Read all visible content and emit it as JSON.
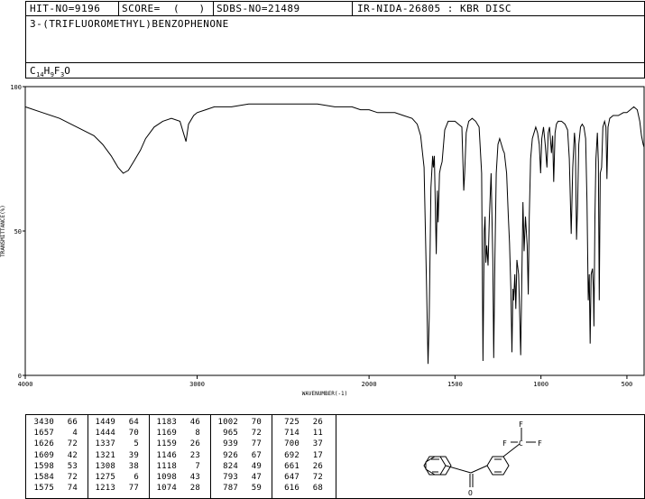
{
  "header": {
    "hit_no": "HIT-NO=9196",
    "score": "SCORE=  (   )",
    "sdbs_no": "SDBS-NO=21489",
    "ir_nida": "IR-NIDA-26805 : KBR DISC",
    "compound_name": "3-(TRIFLUOROMETHYL)BENZOPHENONE",
    "formula_parts": [
      "C",
      "14",
      "H",
      "9",
      "F",
      "3",
      "O"
    ]
  },
  "chart_data": {
    "type": "line",
    "xlabel": "WAVENUMBER(-1)",
    "ylabel": "TRANSMITTANCE(%)",
    "xlim": [
      4000,
      400
    ],
    "ylim": [
      0,
      100
    ],
    "x_ticks": [
      4000,
      3000,
      2000,
      1500,
      1000,
      500
    ],
    "x_tick_labels": [
      "4000",
      "3000",
      "2000",
      "1500",
      "1000",
      "500"
    ],
    "y_ticks": [
      0,
      50,
      100
    ],
    "y_tick_labels": [
      "0",
      "50",
      "100"
    ],
    "series": [
      {
        "points": [
          [
            4000,
            93
          ],
          [
            3900,
            91
          ],
          [
            3800,
            89
          ],
          [
            3700,
            86
          ],
          [
            3600,
            83
          ],
          [
            3550,
            80
          ],
          [
            3500,
            76
          ],
          [
            3460,
            72
          ],
          [
            3430,
            70
          ],
          [
            3400,
            71
          ],
          [
            3370,
            74
          ],
          [
            3330,
            78
          ],
          [
            3300,
            82
          ],
          [
            3250,
            86
          ],
          [
            3200,
            88
          ],
          [
            3150,
            89
          ],
          [
            3100,
            88
          ],
          [
            3080,
            84
          ],
          [
            3065,
            81
          ],
          [
            3050,
            87
          ],
          [
            3020,
            90
          ],
          [
            3000,
            91
          ],
          [
            2950,
            92
          ],
          [
            2900,
            93
          ],
          [
            2800,
            93
          ],
          [
            2700,
            94
          ],
          [
            2600,
            94
          ],
          [
            2500,
            94
          ],
          [
            2400,
            94
          ],
          [
            2300,
            94
          ],
          [
            2200,
            93
          ],
          [
            2100,
            93
          ],
          [
            2050,
            92
          ],
          [
            2000,
            92
          ],
          [
            1950,
            91
          ],
          [
            1900,
            91
          ],
          [
            1850,
            91
          ],
          [
            1800,
            90
          ],
          [
            1750,
            89
          ],
          [
            1720,
            87
          ],
          [
            1700,
            83
          ],
          [
            1680,
            72
          ],
          [
            1665,
            30
          ],
          [
            1657,
            4
          ],
          [
            1650,
            20
          ],
          [
            1640,
            65
          ],
          [
            1630,
            76
          ],
          [
            1626,
            72
          ],
          [
            1620,
            76
          ],
          [
            1609,
            42
          ],
          [
            1603,
            64
          ],
          [
            1598,
            53
          ],
          [
            1590,
            70
          ],
          [
            1584,
            72
          ],
          [
            1575,
            74
          ],
          [
            1560,
            85
          ],
          [
            1540,
            88
          ],
          [
            1520,
            88
          ],
          [
            1500,
            88
          ],
          [
            1480,
            87
          ],
          [
            1460,
            86
          ],
          [
            1449,
            64
          ],
          [
            1444,
            70
          ],
          [
            1435,
            84
          ],
          [
            1420,
            88
          ],
          [
            1400,
            89
          ],
          [
            1380,
            88
          ],
          [
            1360,
            86
          ],
          [
            1345,
            70
          ],
          [
            1337,
            5
          ],
          [
            1330,
            50
          ],
          [
            1325,
            55
          ],
          [
            1321,
            39
          ],
          [
            1315,
            45
          ],
          [
            1308,
            38
          ],
          [
            1300,
            55
          ],
          [
            1290,
            70
          ],
          [
            1280,
            40
          ],
          [
            1275,
            6
          ],
          [
            1268,
            40
          ],
          [
            1260,
            70
          ],
          [
            1250,
            80
          ],
          [
            1240,
            82
          ],
          [
            1230,
            80
          ],
          [
            1220,
            78
          ],
          [
            1213,
            77
          ],
          [
            1200,
            70
          ],
          [
            1190,
            55
          ],
          [
            1183,
            46
          ],
          [
            1175,
            30
          ],
          [
            1169,
            8
          ],
          [
            1163,
            30
          ],
          [
            1159,
            26
          ],
          [
            1152,
            35
          ],
          [
            1146,
            23
          ],
          [
            1140,
            40
          ],
          [
            1130,
            35
          ],
          [
            1123,
            20
          ],
          [
            1118,
            7
          ],
          [
            1112,
            30
          ],
          [
            1105,
            60
          ],
          [
            1098,
            43
          ],
          [
            1090,
            55
          ],
          [
            1080,
            45
          ],
          [
            1074,
            28
          ],
          [
            1068,
            55
          ],
          [
            1060,
            75
          ],
          [
            1050,
            82
          ],
          [
            1040,
            84
          ],
          [
            1030,
            86
          ],
          [
            1020,
            84
          ],
          [
            1010,
            80
          ],
          [
            1002,
            70
          ],
          [
            995,
            82
          ],
          [
            985,
            86
          ],
          [
            975,
            80
          ],
          [
            965,
            72
          ],
          [
            958,
            84
          ],
          [
            950,
            86
          ],
          [
            939,
            77
          ],
          [
            932,
            83
          ],
          [
            926,
            67
          ],
          [
            918,
            84
          ],
          [
            910,
            87
          ],
          [
            900,
            88
          ],
          [
            880,
            88
          ],
          [
            860,
            87
          ],
          [
            845,
            85
          ],
          [
            835,
            75
          ],
          [
            824,
            49
          ],
          [
            815,
            72
          ],
          [
            805,
            84
          ],
          [
            800,
            80
          ],
          [
            793,
            47
          ],
          [
            787,
            59
          ],
          [
            780,
            80
          ],
          [
            770,
            86
          ],
          [
            760,
            87
          ],
          [
            750,
            86
          ],
          [
            740,
            82
          ],
          [
            732,
            60
          ],
          [
            725,
            26
          ],
          [
            719,
            35
          ],
          [
            714,
            11
          ],
          [
            708,
            35
          ],
          [
            700,
            37
          ],
          [
            695,
            30
          ],
          [
            692,
            17
          ],
          [
            686,
            55
          ],
          [
            680,
            75
          ],
          [
            672,
            84
          ],
          [
            666,
            74
          ],
          [
            661,
            26
          ],
          [
            655,
            70
          ],
          [
            647,
            72
          ],
          [
            640,
            86
          ],
          [
            630,
            88
          ],
          [
            622,
            86
          ],
          [
            616,
            68
          ],
          [
            610,
            86
          ],
          [
            600,
            89
          ],
          [
            580,
            90
          ],
          [
            550,
            90
          ],
          [
            520,
            91
          ],
          [
            500,
            91
          ],
          [
            480,
            92
          ],
          [
            460,
            93
          ],
          [
            440,
            92
          ],
          [
            425,
            88
          ],
          [
            415,
            83
          ],
          [
            405,
            80
          ],
          [
            400,
            79
          ]
        ]
      }
    ]
  },
  "peaks": {
    "columns": [
      [
        [
          "3430",
          "66"
        ],
        [
          "1657",
          "4"
        ],
        [
          "1626",
          "72"
        ],
        [
          "1609",
          "42"
        ],
        [
          "1598",
          "53"
        ],
        [
          "1584",
          "72"
        ],
        [
          "1575",
          "74"
        ]
      ],
      [
        [
          "1449",
          "64"
        ],
        [
          "1444",
          "70"
        ],
        [
          "1337",
          "5"
        ],
        [
          "1321",
          "39"
        ],
        [
          "1308",
          "38"
        ],
        [
          "1275",
          "6"
        ],
        [
          "1213",
          "77"
        ]
      ],
      [
        [
          "1183",
          "46"
        ],
        [
          "1169",
          "8"
        ],
        [
          "1159",
          "26"
        ],
        [
          "1146",
          "23"
        ],
        [
          "1118",
          "7"
        ],
        [
          "1098",
          "43"
        ],
        [
          "1074",
          "28"
        ]
      ],
      [
        [
          "1002",
          "70"
        ],
        [
          "965",
          "72"
        ],
        [
          "939",
          "77"
        ],
        [
          "926",
          "67"
        ],
        [
          "824",
          "49"
        ],
        [
          "793",
          "47"
        ],
        [
          "787",
          "59"
        ]
      ],
      [
        [
          "725",
          "26"
        ],
        [
          "714",
          "11"
        ],
        [
          "700",
          "37"
        ],
        [
          "692",
          "17"
        ],
        [
          "661",
          "26"
        ],
        [
          "647",
          "72"
        ],
        [
          "616",
          "68"
        ]
      ]
    ]
  },
  "structure": {
    "atom_f1": "F",
    "atom_f2": "F",
    "atom_f3": "F",
    "atom_c": "C",
    "atom_o": "O"
  }
}
